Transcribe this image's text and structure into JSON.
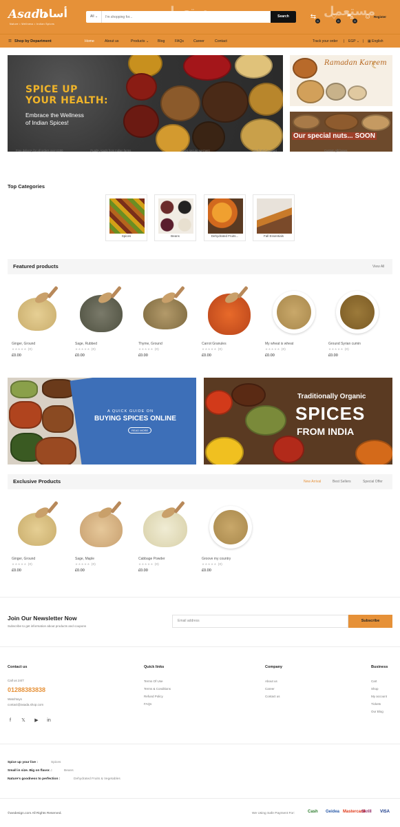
{
  "header": {
    "logo_latin": "Asada",
    "logo_arabic": "أسادا",
    "logo_tagline": "Nature • Wellness • Indian Spices",
    "search_category": "All",
    "search_placeholder": "I'm shopping for...",
    "search_button": "Search",
    "watermark": "مستعمل",
    "register_label": "Register",
    "cart_count": "0",
    "wishlist_count": "0",
    "compare_count": "0"
  },
  "nav": {
    "department": "Shop by Department",
    "items": [
      "Home",
      "About us",
      "Products",
      "Blog",
      "FAQs",
      "Career",
      "Contact"
    ],
    "track_order": "Track your order",
    "currency": "EGP",
    "language": "English"
  },
  "hero": {
    "title_line1": "SPICE UP",
    "title_line2": "YOUR HEALTH:",
    "sub_line1": "Embrace the Wellness",
    "sub_line2": "of Indian Spices!",
    "promo1_title": "Ramadan Kareem",
    "promo2_title": "Our special nuts... SOON"
  },
  "features": [
    "Free delivery for all orders over £100",
    "Quality goods from Indian farms",
    "100% secure payment",
    "Dedicated support",
    "Custom gift boxes"
  ],
  "categories": {
    "title": "Top Categories",
    "items": [
      "Spices",
      "Beans",
      "Dehydrated Fruits...",
      "Fall Essentials"
    ]
  },
  "featured": {
    "title": "Featured products",
    "view_all": "View All",
    "products": [
      {
        "name": "Ginger, Ground",
        "reviews": "(0)",
        "price": "£0.00"
      },
      {
        "name": "Sage, Rubbed",
        "reviews": "(0)",
        "price": "£0.00"
      },
      {
        "name": "Thyme, Ground",
        "reviews": "(0)",
        "price": "£0.00"
      },
      {
        "name": "Carrot Granules",
        "reviews": "(0)",
        "price": "£0.00"
      },
      {
        "name": "My wheat is wheat",
        "reviews": "(0)",
        "price": "£0.00"
      },
      {
        "name": "Ground Syrian cumin",
        "reviews": "(0)",
        "price": "£0.00"
      }
    ]
  },
  "banners": {
    "guide_kicker": "A QUICK GUIDE ON",
    "guide_title": "BUYING SPICES ONLINE",
    "guide_button": "READ MORE",
    "organic_line1": "Traditionally Organic",
    "organic_line2": "SPICES",
    "organic_line3": "FROM INDIA"
  },
  "exclusive": {
    "title": "Exclusive Products",
    "tabs": [
      "New Arrival",
      "Best Sellers",
      "Special Offer"
    ],
    "products": [
      {
        "name": "Ginger, Ground",
        "reviews": "(0)",
        "price": "£0.00"
      },
      {
        "name": "Sage, Maple",
        "reviews": "(0)",
        "price": "£0.00"
      },
      {
        "name": "Cabbage Powder",
        "reviews": "(0)",
        "price": "£0.00"
      },
      {
        "name": "Groove my country",
        "reviews": "(0)",
        "price": "£0.00"
      }
    ]
  },
  "newsletter": {
    "title": "Join Our Newsletter Now",
    "subtitle": "Subscribe to get information about products and coupons",
    "placeholder": "Email address",
    "button": "Subscribe"
  },
  "footer": {
    "contact_title": "Contact us",
    "call_label": "Call us 24/7",
    "phone": "01288383838",
    "address": "Watchtoys",
    "email": "contact@asada.shop.com",
    "quick_title": "Quick links",
    "quick_links": [
      "Terms Of Use",
      "Terms & Conditions",
      "Refund Policy",
      "FAQs"
    ],
    "company_title": "Company",
    "company_links": [
      "About us",
      "Career",
      "Contact us"
    ],
    "business_title": "Business",
    "business_links": [
      "Cart",
      "Shop",
      "My account",
      "Tickets",
      "Our Blog"
    ],
    "taglines": [
      {
        "label": "Spice up your live :",
        "value": "Spices"
      },
      {
        "label": "Small in size. Big on flavor. :",
        "value": "Beans"
      },
      {
        "label": "Nature's goodness to perfection :",
        "value": "Dehydrated Fruits & Vegetables"
      }
    ],
    "copyright": "©wedesign.com All Rights Reserved.",
    "payment_label": "We Using Safe Payment For:",
    "payments": [
      "Cash",
      "Geidea",
      "Mastercard",
      "Skrill",
      "VISA"
    ]
  }
}
